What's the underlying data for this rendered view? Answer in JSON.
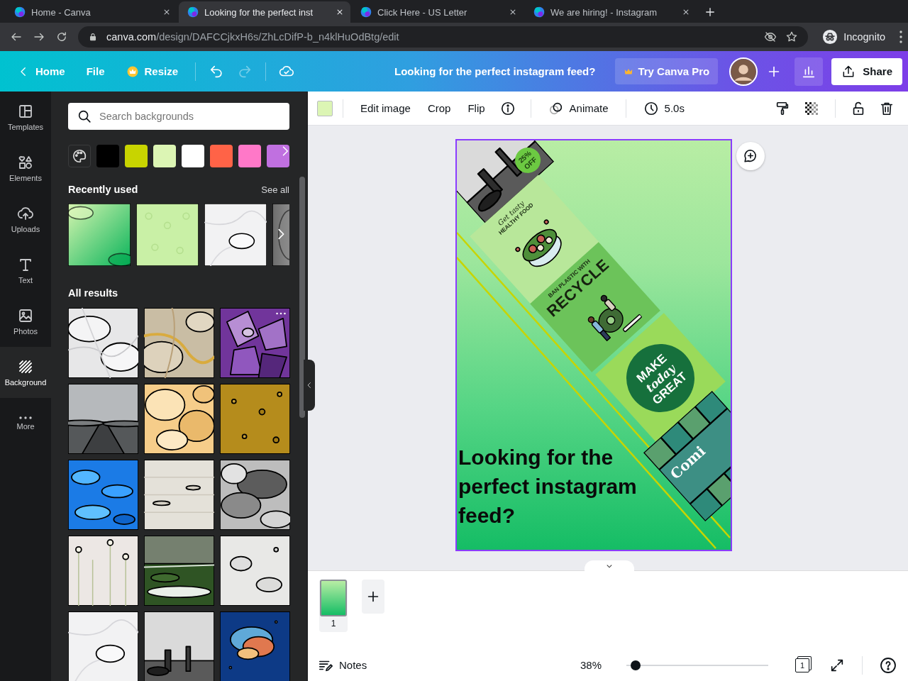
{
  "browser": {
    "tabs": [
      {
        "title": "Home - Canva",
        "selected": false
      },
      {
        "title": "Looking for the perfect inst",
        "selected": true
      },
      {
        "title": "Click Here - US Letter",
        "selected": false
      },
      {
        "title": "We are hiring! - Instagram",
        "selected": false
      }
    ],
    "url_domain": "canva.com",
    "url_path": "/design/DAFCCjkxH6s/ZhLcDifP-b_n4klHuOdBtg/edit",
    "profile": "Incognito"
  },
  "header": {
    "home": "Home",
    "file": "File",
    "resize": "Resize",
    "design_title": "Looking for the perfect instagram feed?",
    "try_pro": "Try Canva Pro",
    "share": "Share"
  },
  "rail": [
    {
      "label": "Templates",
      "selected": false
    },
    {
      "label": "Elements",
      "selected": false
    },
    {
      "label": "Uploads",
      "selected": false
    },
    {
      "label": "Text",
      "selected": false
    },
    {
      "label": "Photos",
      "selected": false
    },
    {
      "label": "Background",
      "selected": true
    },
    {
      "label": "More",
      "selected": false
    }
  ],
  "panel": {
    "search_placeholder": "Search backgrounds",
    "swatches": [
      {
        "color": "#000000"
      },
      {
        "color": "#c8d400"
      },
      {
        "color": "#dcf5b4"
      },
      {
        "color": "#ffffff"
      },
      {
        "color": "#ff6347"
      },
      {
        "color": "#ff78c8"
      },
      {
        "color": "#c070e0"
      }
    ],
    "recent_title": "Recently used",
    "see_all": "See all",
    "recent": [
      {
        "kind": "picture"
      },
      {
        "kind": "picture"
      },
      {
        "kind": "picture"
      },
      {
        "kind": "picture"
      }
    ],
    "all_title": "All results",
    "results": [
      {
        "kind": "picture",
        "hovered": false
      },
      {
        "kind": "picture",
        "hovered": false
      },
      {
        "kind": "picture",
        "hovered": true
      },
      {
        "kind": "picture",
        "hovered": false
      },
      {
        "kind": "picture",
        "hovered": false
      },
      {
        "kind": "picture",
        "hovered": false
      },
      {
        "kind": "picture",
        "hovered": false
      },
      {
        "kind": "picture",
        "hovered": false
      },
      {
        "kind": "picture",
        "hovered": false
      },
      {
        "kind": "picture",
        "hovered": false
      },
      {
        "kind": "picture",
        "hovered": false
      },
      {
        "kind": "picture",
        "hovered": false
      },
      {
        "kind": "picture",
        "hovered": false
      },
      {
        "kind": "picture",
        "hovered": false
      },
      {
        "kind": "picture",
        "hovered": false
      }
    ]
  },
  "toolbar": {
    "actions": [
      "Edit image",
      "Crop",
      "Flip"
    ],
    "animate": "Animate",
    "duration": "5.0s"
  },
  "design": {
    "heading": "Looking for the perfect instagram feed?",
    "posts": [
      {
        "lines": [
          "25% OFF"
        ]
      },
      {
        "kind": "food",
        "lines": [
          "Get tasty",
          "HEALTHY FOOD"
        ]
      },
      {
        "kind": "recycle",
        "lines": [
          "BAN PLASTIC WITH",
          "RECYCLE"
        ]
      },
      {
        "kind": "badge",
        "lines": [
          "MAKE",
          "today",
          "GREAT"
        ]
      },
      {
        "kind": "pattern",
        "lines": [
          "Comi"
        ]
      }
    ]
  },
  "pages": [
    {
      "number": "1",
      "selected": true
    }
  ],
  "footer": {
    "notes": "Notes",
    "zoom": "38%",
    "zoom_slider": {
      "level": 0.06
    },
    "page_count": "1"
  }
}
